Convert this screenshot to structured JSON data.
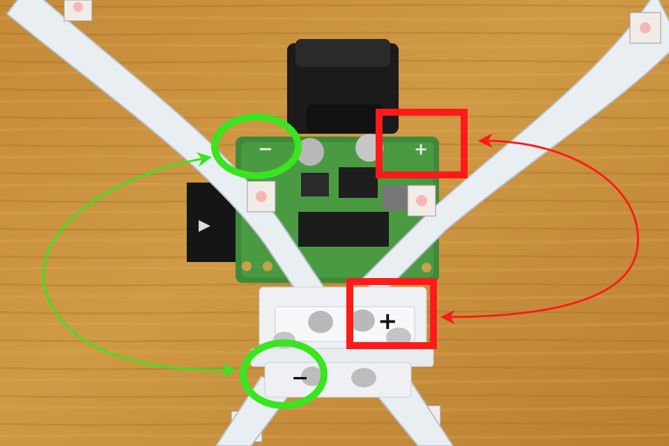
{
  "photo": {
    "subject": "led-strip-soldered-to-control-board",
    "silkscreen": {
      "board_minus": "−",
      "board_plus": "+",
      "connector_plus": "+",
      "connector_minus": "−"
    }
  },
  "annotations": {
    "negative_color": "#38e51f",
    "positive_color": "#ff1a1a"
  },
  "colors": {
    "table_wood": "#c98f3c",
    "led_strip": "#e9eef2",
    "pcb_green": "#3f8a3a",
    "pcb_connector_white": "#eef0f3",
    "battery_holder": "#1b1b1b",
    "led_package": "#f2ece9"
  }
}
